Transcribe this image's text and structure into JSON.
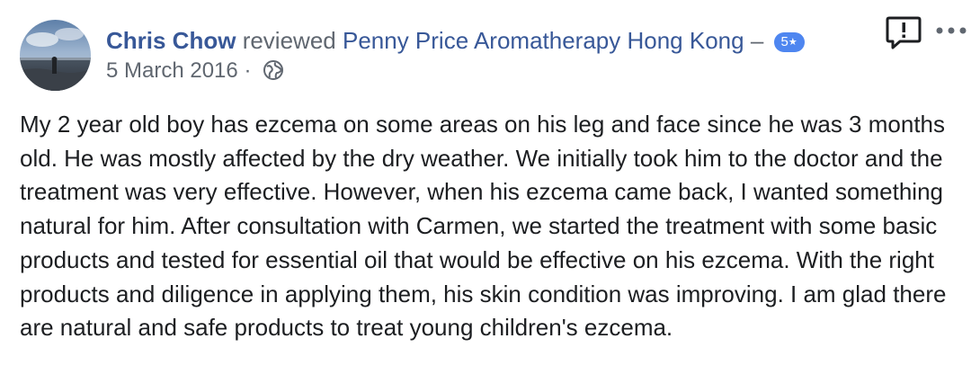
{
  "review": {
    "author": "Chris Chow",
    "verb": "reviewed",
    "page": "Penny Price Aromatherapy Hong Kong",
    "dash": "–",
    "rating": "5",
    "rating_star": "★",
    "date": "5 March 2016",
    "separator": "·",
    "privacy_icon": "globe-icon",
    "body": "My 2 year old boy has ezcema on some areas on his leg and face since he was 3 months old. He was mostly affected by the dry weather. We initially took him to the doctor and the treatment was very effective. However, when his ezcema came back, I wanted something natural for him. After consultation with Carmen, we started the treatment with some basic products and tested for essential oil that would be effective on his ezcema. With the right products and diligence in applying them, his skin condition was improving. I am glad there are natural and safe products to treat young children's ezcema."
  },
  "actions": {
    "report_icon": "report-icon",
    "more_icon": "more-options-icon"
  },
  "colors": {
    "link": "#385898",
    "meta_text": "#606770",
    "body_text": "#1c1e21",
    "badge": "#4e86f0"
  }
}
